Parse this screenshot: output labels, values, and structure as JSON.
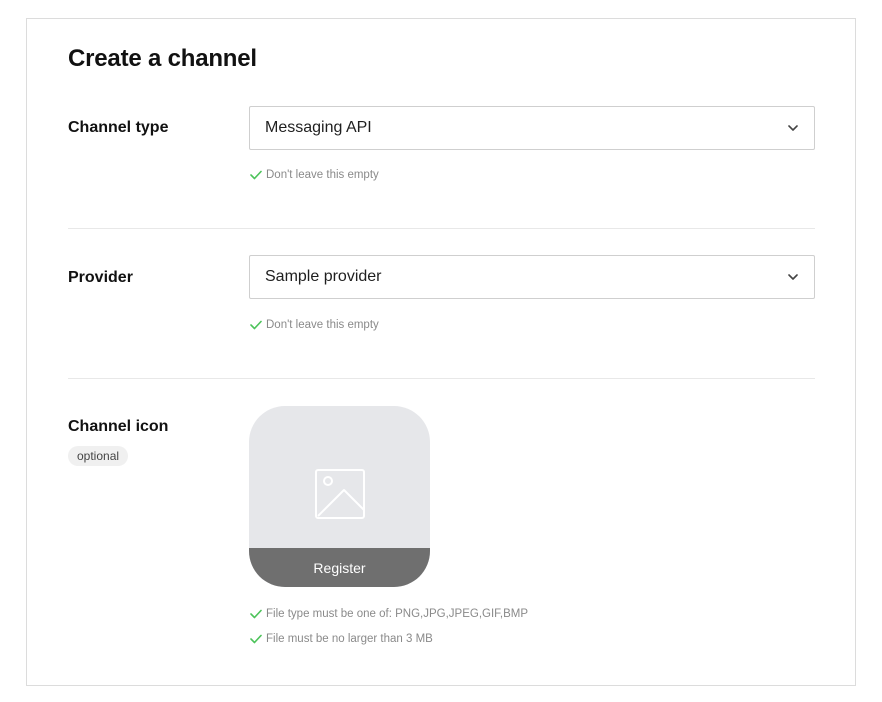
{
  "page": {
    "title": "Create a channel"
  },
  "colors": {
    "check": "#4cc35a",
    "hint_text": "#8a8a8a",
    "register_bg": "#6f6f6f",
    "icon_bg": "#e6e7ea"
  },
  "channel_type": {
    "label": "Channel type",
    "value": "Messaging API",
    "hint": "Don't leave this empty"
  },
  "provider": {
    "label": "Provider",
    "value": "Sample provider",
    "hint": "Don't leave this empty"
  },
  "channel_icon": {
    "label": "Channel icon",
    "badge": "optional",
    "register_label": "Register",
    "hints": [
      "File type must be one of: PNG,JPG,JPEG,GIF,BMP",
      "File must be no larger than 3 MB"
    ]
  }
}
